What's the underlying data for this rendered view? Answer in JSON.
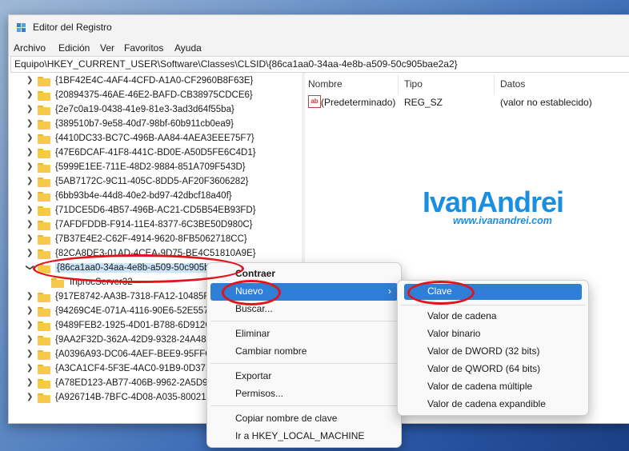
{
  "window": {
    "title": "Editor del Registro"
  },
  "menu": [
    "Archivo",
    "Edición",
    "Ver",
    "Favoritos",
    "Ayuda"
  ],
  "address": "Equipo\\HKEY_CURRENT_USER\\Software\\Classes\\CLSID\\{86ca1aa0-34aa-4e8b-a509-50c905bae2a2}",
  "tree": {
    "items_above": [
      "{1BF42E4C-4AF4-4CFD-A1A0-CF2960B8F63E}",
      "{20894375-46AE-46E2-BAFD-CB38975CDCE6}",
      "{2e7c0a19-0438-41e9-81e3-3ad3d64f55ba}",
      "{389510b7-9e58-40d7-98bf-60b911cb0ea9}",
      "{4410DC33-BC7C-496B-AA84-4AEA3EEE75F7}",
      "{47E6DCAF-41F8-441C-BD0E-A50D5FE6C4D1}",
      "{5999E1EE-711E-48D2-9884-851A709F543D}",
      "{5AB7172C-9C11-405C-8DD5-AF20F3606282}",
      "{6bb93b4e-44d8-40e2-bd97-42dbcf18a40f}",
      "{71DCE5D6-4B57-496B-AC21-CD5B54EB93FD}",
      "{7AFDFDDB-F914-11E4-8377-6C3BE50D980C}",
      "{7B37E4E2-C62F-4914-9620-8FB5062718CC}",
      "{82CA8DE3-01AD-4CEA-9D75-BE4C51810A9E}"
    ],
    "selected": "{86ca1aa0-34aa-4e8b-a509-50c905b",
    "child": "InprocServer32",
    "items_below": [
      "{917E8742-AA3B-7318-FA12-10485F",
      "{94269C4E-071A-4116-90E6-52E557",
      "{9489FEB2-1925-4D01-B788-6D912C",
      "{9AA2F32D-362A-42D9-9328-24A48",
      "{A0396A93-DC06-4AEF-BEE9-95FFC",
      "{A3CA1CF4-5F3E-4AC0-91B9-0D371",
      "{A78ED123-AB77-406B-9962-2A5D9",
      "{A926714B-7BFC-4D08-A035-800213"
    ]
  },
  "list": {
    "headers": {
      "name": "Nombre",
      "type": "Tipo",
      "data": "Datos"
    },
    "row": {
      "icon": "ab",
      "name": "(Predeterminado)",
      "type": "REG_SZ",
      "data": "(valor no establecido)"
    }
  },
  "watermark": {
    "brand": "IvanAndrei",
    "url": "www.ivanandrei.com"
  },
  "context_menu": {
    "items": [
      "Contraer",
      "Nuevo",
      "Buscar...",
      "Eliminar",
      "Cambiar nombre",
      "Exportar",
      "Permisos...",
      "Copiar nombre de clave",
      "Ir a HKEY_LOCAL_MACHINE"
    ],
    "submenu_arrow": "›"
  },
  "submenu": {
    "items": [
      "Clave",
      "Valor de cadena",
      "Valor binario",
      "Valor de DWORD (32 bits)",
      "Valor de QWORD (64 bits)",
      "Valor de cadena múltiple",
      "Valor de cadena expandible"
    ]
  },
  "colors": {
    "highlight": "#2f7fd8",
    "annotation": "#e0141b",
    "folder": "#f7c948",
    "watermark": "#1a8fe0"
  }
}
